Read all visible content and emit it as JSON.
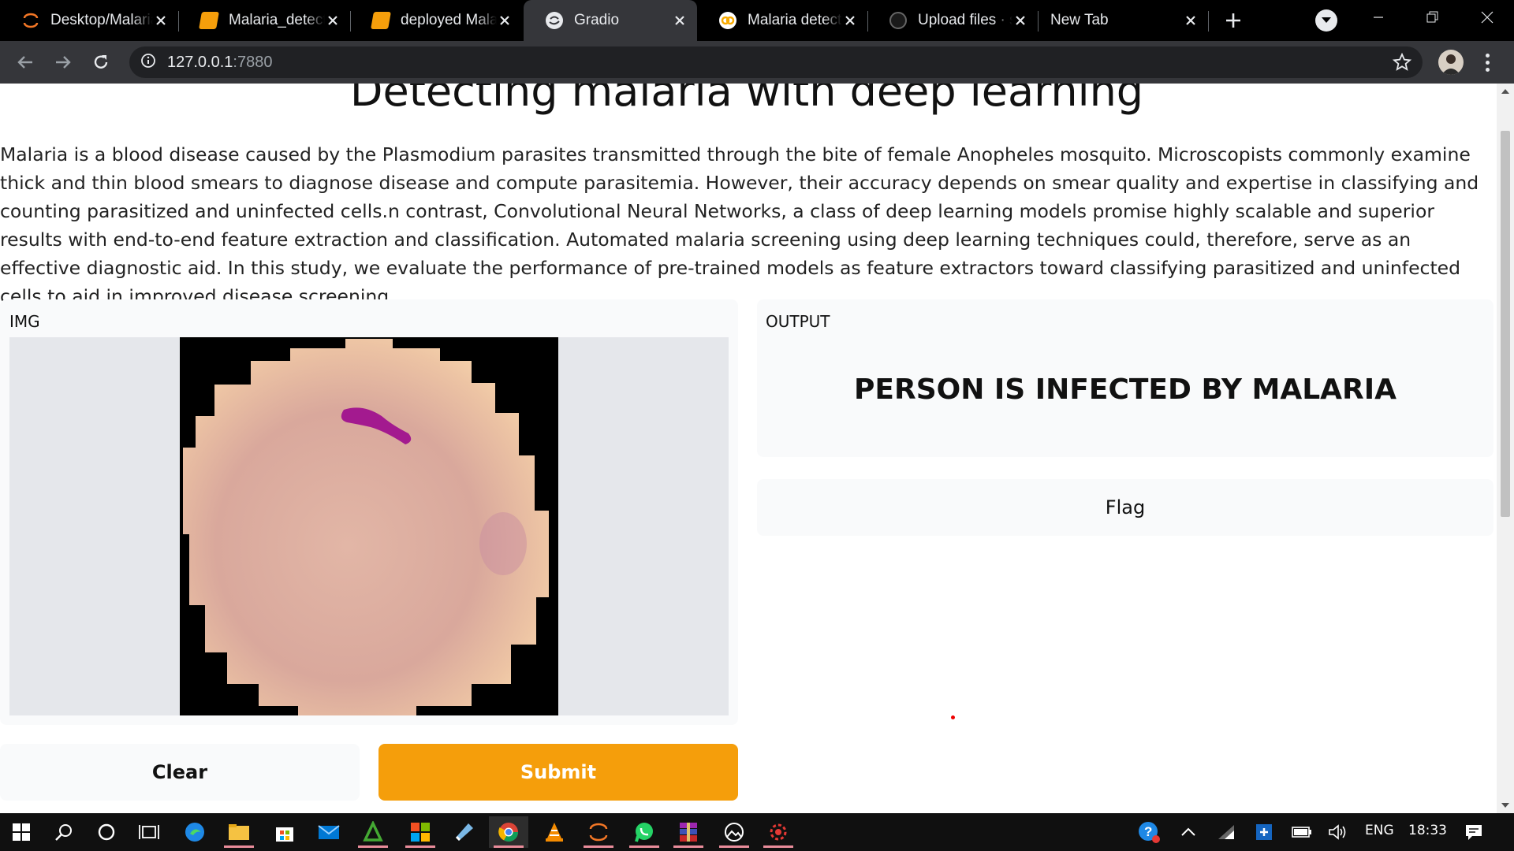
{
  "browser": {
    "tabs": [
      {
        "title": "Desktop/Malaria_detection",
        "icon": "jupyter-icon",
        "active": false
      },
      {
        "title": "Malaria_detection",
        "icon": "notebook-icon",
        "active": false
      },
      {
        "title": "deployed Malaria",
        "icon": "notebook-icon",
        "active": false
      },
      {
        "title": "Gradio",
        "icon": "gradio-icon",
        "active": true
      },
      {
        "title": "Malaria detection",
        "icon": "colab-icon",
        "active": false
      },
      {
        "title": "Upload files · spinner",
        "icon": "github-icon",
        "active": false
      },
      {
        "title": "New Tab",
        "icon": "",
        "active": false
      }
    ],
    "url_host": "127.0.0.1",
    "url_port": ":7880"
  },
  "page": {
    "title": "Detecting malaria with deep learning",
    "description": "Malaria is a blood disease caused by the Plasmodium parasites transmitted through the bite of female Anopheles mosquito. Microscopists commonly examine thick and thin blood smears to diagnose disease and compute parasitemia. However, their accuracy depends on smear quality and expertise in classifying and counting parasitized and uninfected cells.n contrast, Convolutional Neural Networks, a class of deep learning models promise highly scalable and superior results with end-to-end feature extraction and classification. Automated malaria screening using deep learning techniques could, therefore, serve as an effective diagnostic aid. In this study, we evaluate the performance of pre-trained models as feature extractors toward classifying parasitized and uninfected cells to aid in improved disease screening",
    "input_label": "IMG",
    "output_label": "OUTPUT",
    "output_text": "PERSON IS INFECTED BY MALARIA",
    "flag_label": "Flag",
    "clear_label": "Clear",
    "submit_label": "Submit",
    "accent_color": "#f59e0b"
  },
  "taskbar": {
    "language": "ENG",
    "time": "18:33",
    "apps": [
      "edge-icon",
      "file-explorer-icon",
      "store-icon",
      "mail-icon",
      "anaconda-icon",
      "office-icon",
      "notepad-icon",
      "chrome-icon",
      "vlc-icon",
      "jupyter-icon",
      "whatsapp-icon",
      "winrar-icon",
      "photos-icon",
      "settings-app-icon"
    ]
  }
}
